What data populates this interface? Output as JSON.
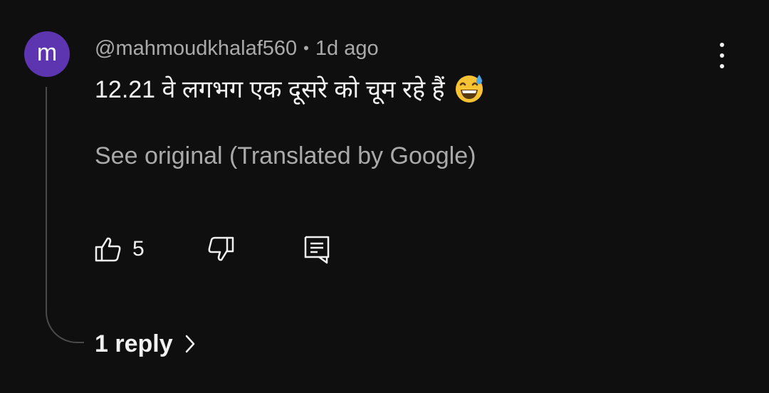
{
  "comment": {
    "avatar_letter": "m",
    "avatar_color": "#5e35b1",
    "author": "@mahmoudkhalaf560",
    "separator": "•",
    "time": "1d ago",
    "text": "12.21 वे लगभग एक दूसरे को चूम रहे हैं",
    "emoji": "grinning-face-with-sweat",
    "translation_link": "See original (Translated by Google)",
    "like_count": "5",
    "replies_label": "1 reply"
  },
  "icons": {
    "more": "more-vertical-icon",
    "like": "thumbs-up-icon",
    "dislike": "thumbs-down-icon",
    "reply": "comment-icon",
    "chevron": "chevron-right-icon"
  }
}
